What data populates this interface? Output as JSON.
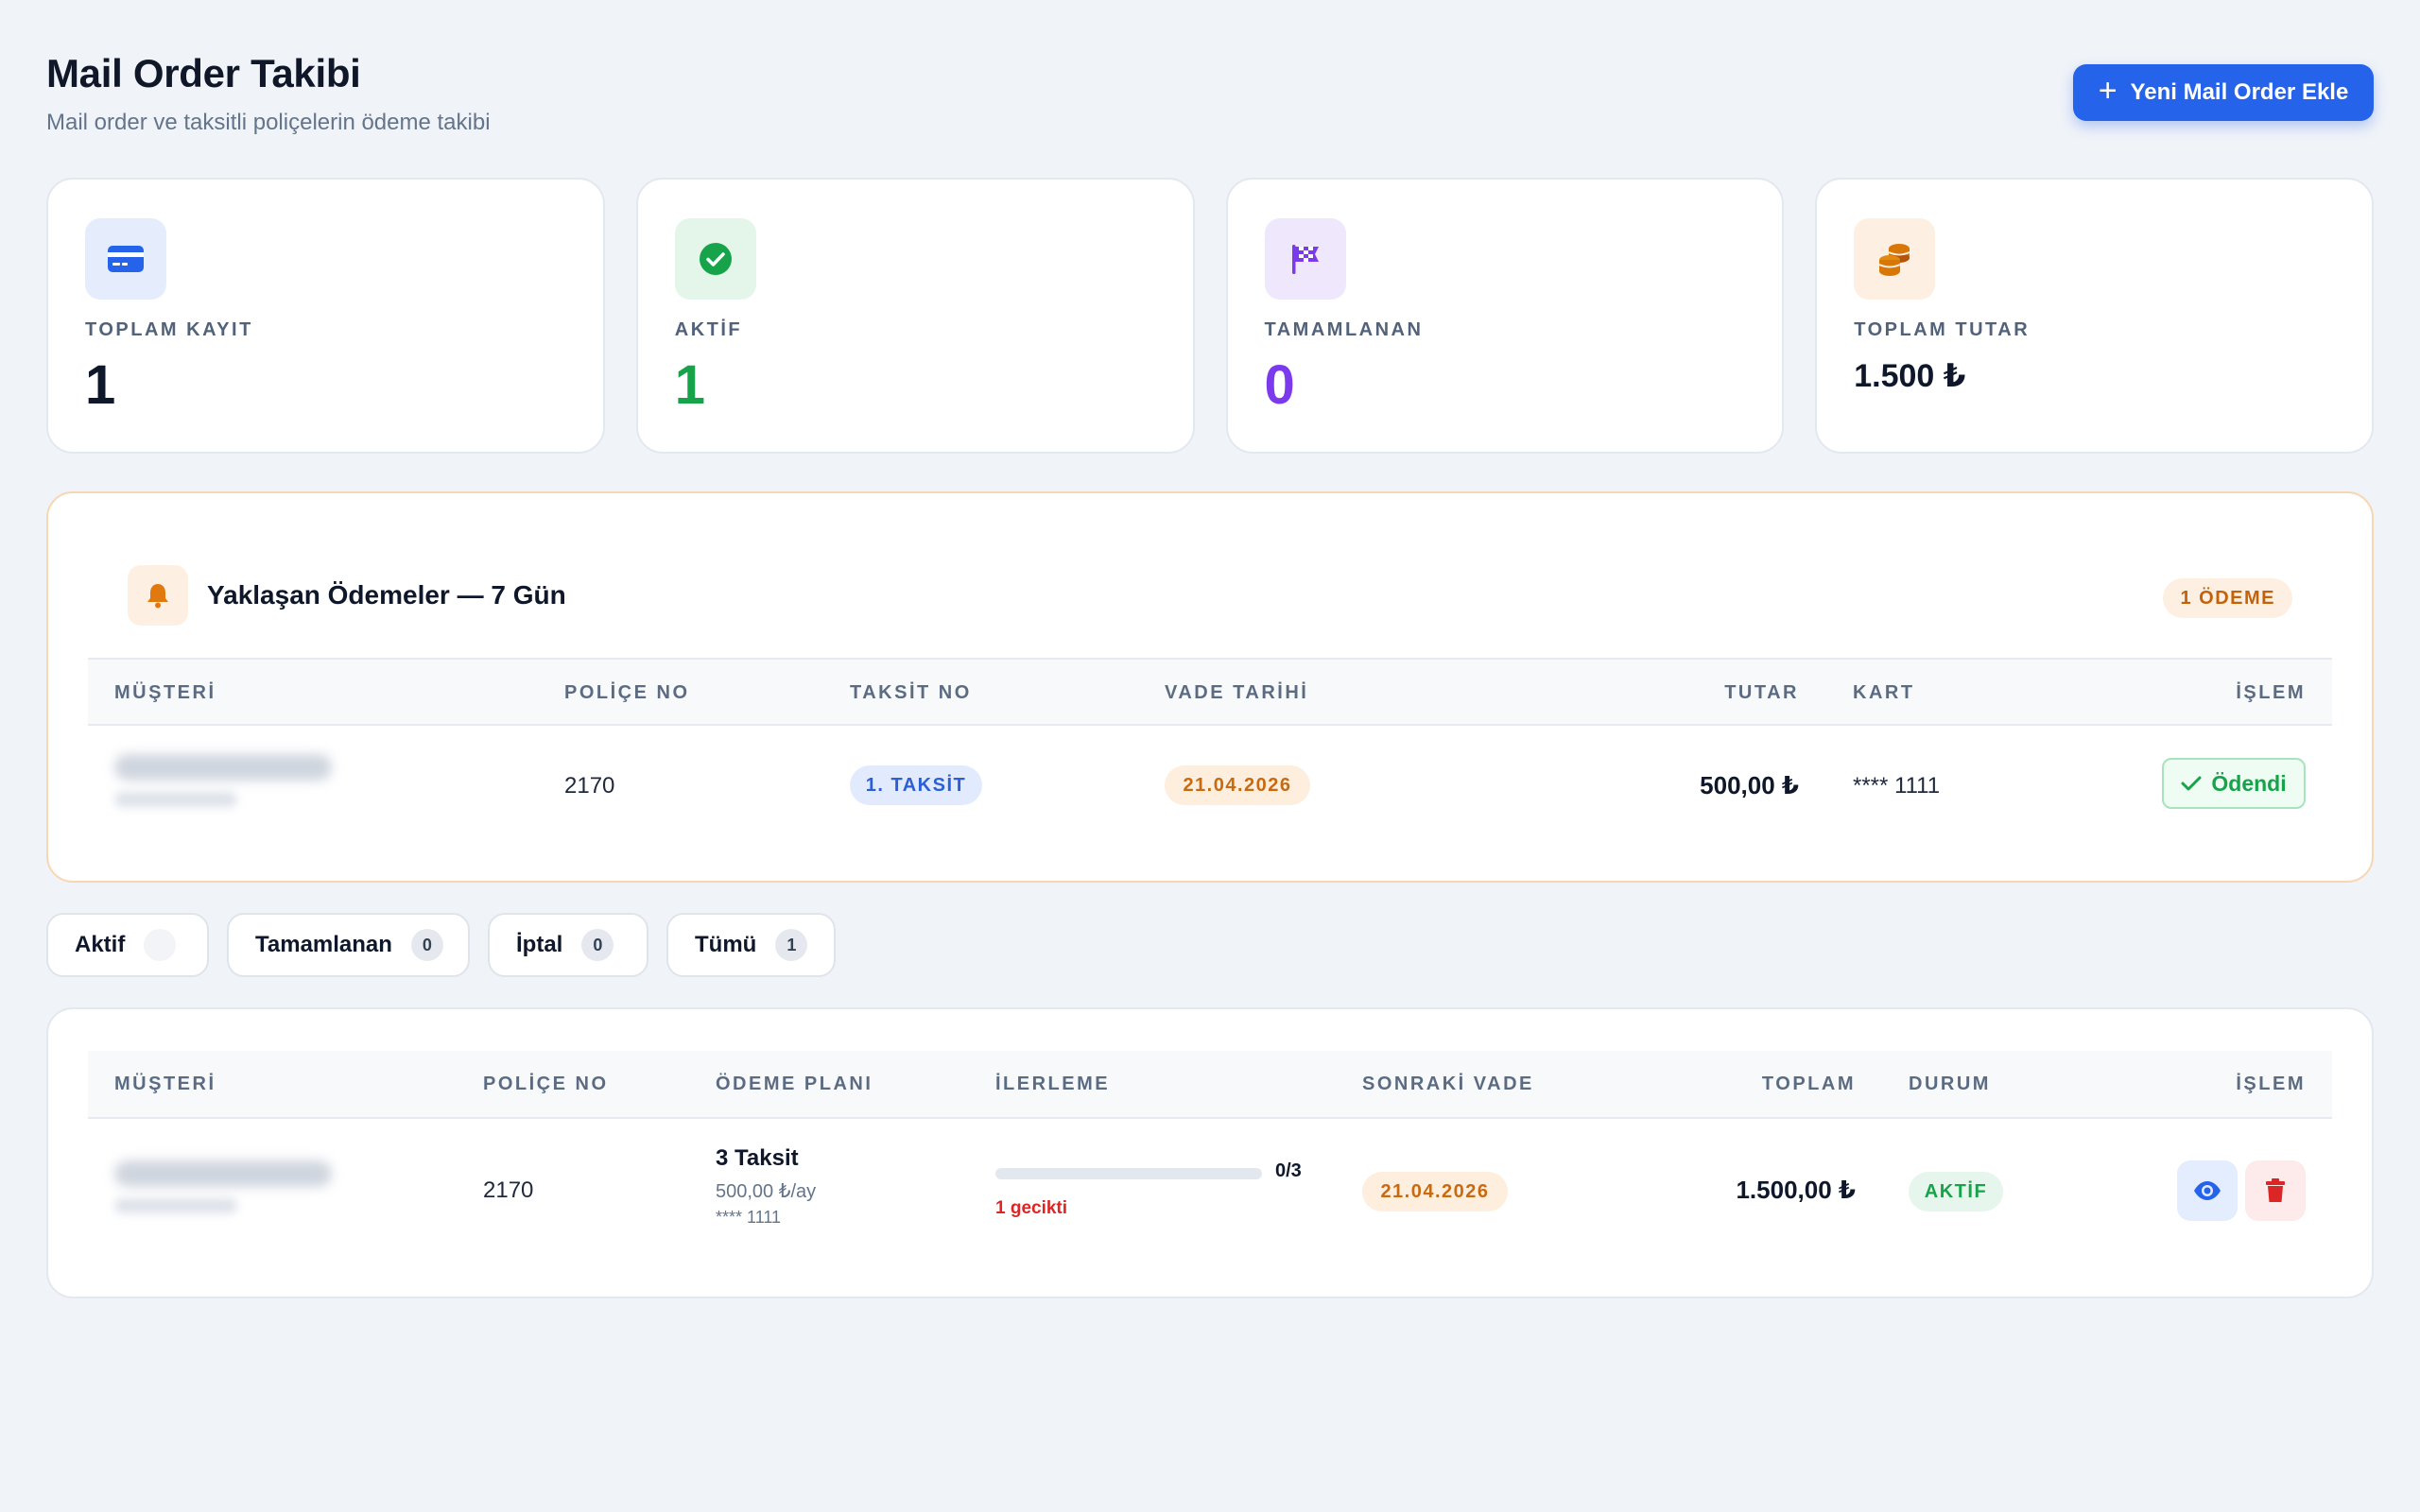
{
  "header": {
    "title": "Mail Order Takibi",
    "subtitle": "Mail order ve taksitli poliçelerin ödeme takibi",
    "add_button": "Yeni Mail Order Ekle"
  },
  "stats": [
    {
      "label": "TOPLAM KAYIT",
      "value": "1",
      "icon": "credit-card-icon",
      "color": "#2563eb",
      "bg": "#e5edfd"
    },
    {
      "label": "AKTİF",
      "value": "1",
      "icon": "check-circle-icon",
      "color": "#16a34a",
      "bg": "#e4f5ea"
    },
    {
      "label": "TAMAMLANAN",
      "value": "0",
      "icon": "checkered-flag-icon",
      "color": "#7c3aed",
      "bg": "#efe8fd"
    },
    {
      "label": "TOPLAM TUTAR",
      "value": "1.500 ₺",
      "icon": "coins-icon",
      "color": "#d97706",
      "bg": "#fdf0e2"
    }
  ],
  "upcoming": {
    "title": "Yaklaşan Ödemeler — 7 Gün",
    "badge": "1 ÖDEME",
    "columns": [
      "MÜŞTERİ",
      "POLİÇE NO",
      "TAKSİT NO",
      "VADE TARİHİ",
      "TUTAR",
      "KART",
      "İŞLEM"
    ],
    "rows": [
      {
        "policy_no": "2170",
        "installment": "1. TAKSİT",
        "due_date": "21.04.2026",
        "amount": "500,00 ₺",
        "card": "**** 1111",
        "action": "Ödendi"
      }
    ]
  },
  "filters": [
    {
      "label": "Aktif",
      "count": ""
    },
    {
      "label": "Tamamlanan",
      "count": "0"
    },
    {
      "label": "İptal",
      "count": "0"
    },
    {
      "label": "Tümü",
      "count": "1"
    }
  ],
  "orders": {
    "columns": [
      "MÜŞTERİ",
      "POLİÇE NO",
      "ÖDEME PLANI",
      "İLERLEME",
      "SONRAKİ VADE",
      "TOPLAM",
      "DURUM",
      "İŞLEM"
    ],
    "rows": [
      {
        "policy_no": "2170",
        "plan_title": "3 Taksit",
        "plan_amount": "500,00 ₺/ay",
        "plan_card": "**** 1111",
        "progress_text": "0/3",
        "progress_fraction": 0,
        "late_text": "1 gecikti",
        "next_due": "21.04.2026",
        "total": "1.500,00 ₺",
        "status": "AKTİF"
      }
    ]
  }
}
